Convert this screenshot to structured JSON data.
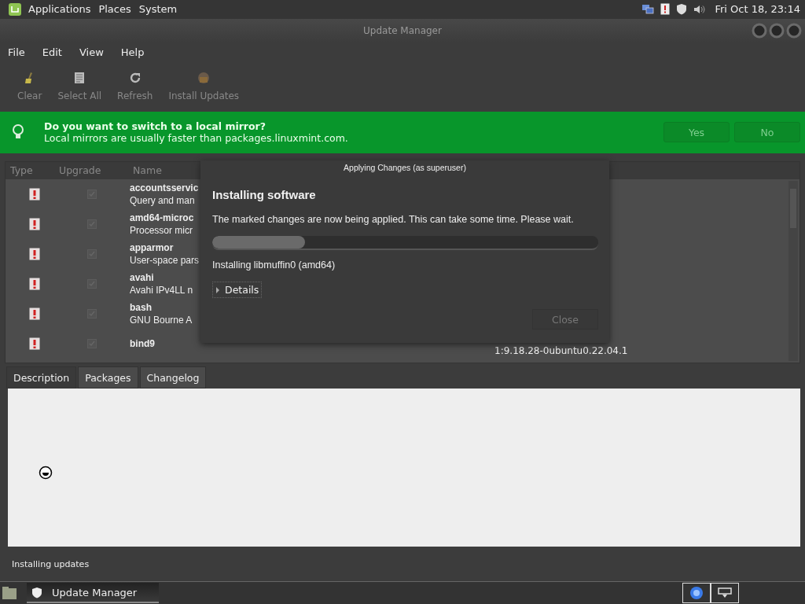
{
  "top_panel": {
    "menus": [
      "Applications",
      "Places",
      "System"
    ],
    "clock": "Fri Oct 18, 23:14"
  },
  "window": {
    "title": "Update Manager"
  },
  "menu_bar": [
    "File",
    "Edit",
    "View",
    "Help"
  ],
  "toolbar": [
    {
      "label": "Clear",
      "kind": "broom",
      "disabled": true
    },
    {
      "label": "Select All",
      "kind": "page",
      "disabled": true
    },
    {
      "label": "Refresh",
      "kind": "refresh",
      "disabled": true
    },
    {
      "label": "Install Updates",
      "kind": "install",
      "disabled": true
    }
  ],
  "banner": {
    "title": "Do you want to switch to a local mirror?",
    "text": "Local mirrors are usually faster than packages.linuxmint.com.",
    "buttons": [
      "Yes",
      "No"
    ]
  },
  "table": {
    "columns": [
      "Type",
      "Upgrade",
      "Name"
    ],
    "rows": [
      {
        "kind": "security",
        "upgrade": true,
        "name": "accountsservic",
        "description": "Query and man"
      },
      {
        "kind": "security",
        "upgrade": true,
        "name": "amd64-microc",
        "description": "Processor micr"
      },
      {
        "kind": "security",
        "upgrade": true,
        "name": "apparmor",
        "description": "User-space pars"
      },
      {
        "kind": "security",
        "upgrade": true,
        "name": "avahi",
        "description": "Avahi IPv4LL n"
      },
      {
        "kind": "security",
        "upgrade": true,
        "name": "bash",
        "description": "GNU Bourne A"
      },
      {
        "kind": "security",
        "upgrade": true,
        "name": "bind9",
        "description": "",
        "version": "1:9.18.28-0ubuntu0.22.04.1"
      }
    ]
  },
  "tabs": [
    {
      "label": "Description",
      "selected": true
    },
    {
      "label": "Packages",
      "selected": false
    },
    {
      "label": "Changelog",
      "selected": false
    }
  ],
  "status_bar": "Installing updates",
  "dialog": {
    "title": "Applying Changes (as superuser)",
    "heading": "Installing software",
    "message": "The marked changes are now being applied. This can take some time. Please wait.",
    "progress": {
      "level": 0.24
    },
    "status": "Installing libmuffin0 (amd64)",
    "details": {
      "label": "Details",
      "expanded": false
    },
    "button": {
      "label": "Close",
      "disabled": true
    }
  },
  "taskbar": {
    "windows": [
      {
        "label": "Update Manager",
        "selected": true
      }
    ]
  }
}
